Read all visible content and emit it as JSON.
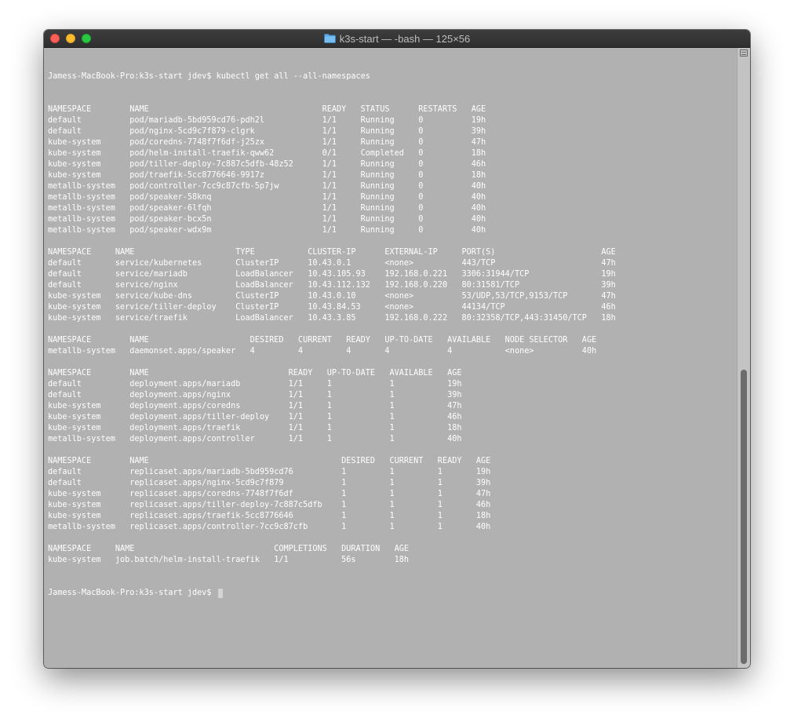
{
  "window": {
    "title": "k3s-start — -bash — 125×56"
  },
  "terminal": {
    "command_line": "Jamess-MacBook-Pro:k3s-start jdev$ kubectl get all --all-namespaces",
    "lines": [
      "NAMESPACE        NAME                                    READY   STATUS      RESTARTS   AGE",
      "default          pod/mariadb-5bd959cd76-pdh2l            1/1     Running     0          19h",
      "default          pod/nginx-5cd9c7f879-clgrk              1/1     Running     0          39h",
      "kube-system      pod/coredns-7748f7f6df-j25zx            1/1     Running     0          47h",
      "kube-system      pod/helm-install-traefik-qww62          0/1     Completed   0          18h",
      "kube-system      pod/tiller-deploy-7c887c5dfb-48z52      1/1     Running     0          46h",
      "kube-system      pod/traefik-5cc8776646-9917z            1/1     Running     0          18h",
      "metallb-system   pod/controller-7cc9c87cfb-5p7jw         1/1     Running     0          40h",
      "metallb-system   pod/speaker-58knq                       1/1     Running     0          40h",
      "metallb-system   pod/speaker-6lfqh                       1/1     Running     0          40h",
      "metallb-system   pod/speaker-bcx5n                       1/1     Running     0          40h",
      "metallb-system   pod/speaker-wdx9m                       1/1     Running     0          40h",
      "",
      "NAMESPACE     NAME                     TYPE           CLUSTER-IP      EXTERNAL-IP     PORT(S)                      AGE",
      "default       service/kubernetes       ClusterIP      10.43.0.1       <none>          443/TCP                      47h",
      "default       service/mariadb          LoadBalancer   10.43.105.93    192.168.0.221   3306:31944/TCP               19h",
      "default       service/nginx            LoadBalancer   10.43.112.132   192.168.0.220   80:31581/TCP                 39h",
      "kube-system   service/kube-dns         ClusterIP      10.43.0.10      <none>          53/UDP,53/TCP,9153/TCP       47h",
      "kube-system   service/tiller-deploy    ClusterIP      10.43.84.53     <none>          44134/TCP                    46h",
      "kube-system   service/traefik          LoadBalancer   10.43.3.85      192.168.0.222   80:32358/TCP,443:31450/TCP   18h",
      "",
      "NAMESPACE        NAME                     DESIRED   CURRENT   READY   UP-TO-DATE   AVAILABLE   NODE SELECTOR   AGE",
      "metallb-system   daemonset.apps/speaker   4         4         4       4            4           <none>          40h",
      "",
      "NAMESPACE        NAME                             READY   UP-TO-DATE   AVAILABLE   AGE",
      "default          deployment.apps/mariadb          1/1     1            1           19h",
      "default          deployment.apps/nginx            1/1     1            1           39h",
      "kube-system      deployment.apps/coredns          1/1     1            1           47h",
      "kube-system      deployment.apps/tiller-deploy    1/1     1            1           46h",
      "kube-system      deployment.apps/traefik          1/1     1            1           18h",
      "metallb-system   deployment.apps/controller       1/1     1            1           40h",
      "",
      "NAMESPACE        NAME                                        DESIRED   CURRENT   READY   AGE",
      "default          replicaset.apps/mariadb-5bd959cd76          1         1         1       19h",
      "default          replicaset.apps/nginx-5cd9c7f879            1         1         1       39h",
      "kube-system      replicaset.apps/coredns-7748f7f6df          1         1         1       47h",
      "kube-system      replicaset.apps/tiller-deploy-7c887c5dfb    1         1         1       46h",
      "kube-system      replicaset.apps/traefik-5cc8776646          1         1         1       18h",
      "metallb-system   replicaset.apps/controller-7cc9c87cfb       1         1         1       40h",
      "",
      "NAMESPACE     NAME                             COMPLETIONS   DURATION   AGE",
      "kube-system   job.batch/helm-install-traefik   1/1           56s        18h"
    ],
    "prompt": "Jamess-MacBook-Pro:k3s-start jdev$ "
  }
}
